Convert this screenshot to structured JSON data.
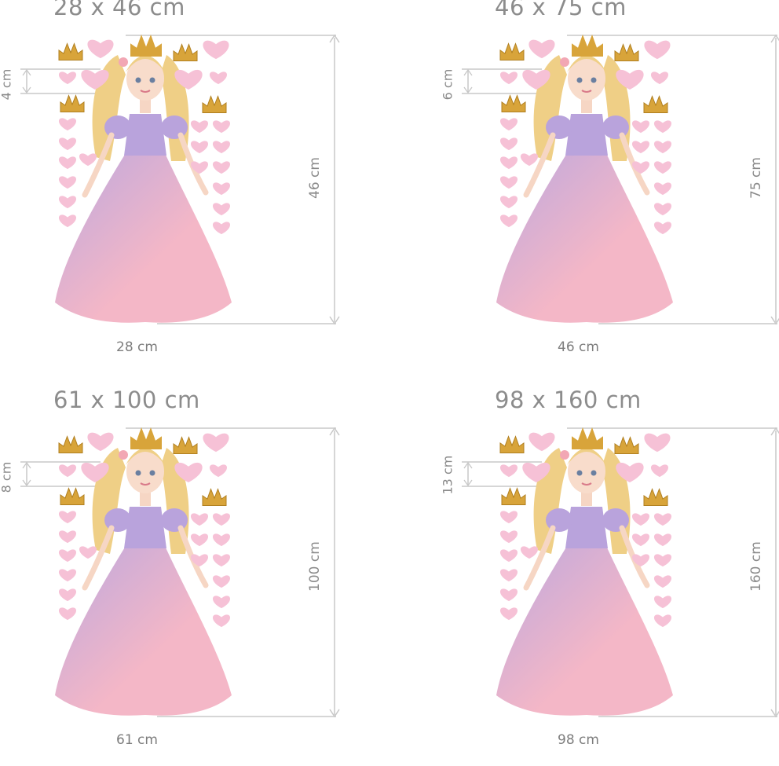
{
  "panels": [
    {
      "title": "28 x 46 cm",
      "width_label": "28 cm",
      "height_label": "46 cm",
      "element_label": "4 cm"
    },
    {
      "title": "46 x 75 cm",
      "width_label": "46 cm",
      "height_label": "75 cm",
      "element_label": "6 cm"
    },
    {
      "title": "61 x 100 cm",
      "width_label": "61 cm",
      "height_label": "100 cm",
      "element_label": "8 cm"
    },
    {
      "title": "98 x 160 cm",
      "width_label": "98 cm",
      "height_label": "160 cm",
      "element_label": "13 cm"
    }
  ],
  "colors": {
    "dimension_line": "#c8c8c8",
    "dress_pink": "#f3b3c4",
    "dress_lavender": "#b9a3dc",
    "hair": "#efcf86",
    "crown_gold": "#d8a43a",
    "heart_pink": "#f6c1d6"
  },
  "icons": [
    "princess-illustration",
    "crown-icon",
    "heart-icon"
  ]
}
